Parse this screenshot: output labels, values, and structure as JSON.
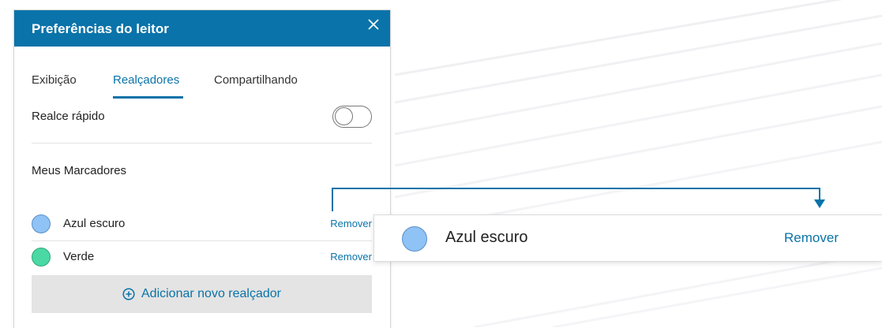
{
  "panel": {
    "title": "Preferências do leitor",
    "close_icon": "close-icon",
    "tabs": [
      {
        "label": "Exibição",
        "active": false
      },
      {
        "label": "Realçadores",
        "active": true
      },
      {
        "label": "Compartilhando",
        "active": false
      }
    ],
    "quick_highlight": {
      "label": "Realce rápido",
      "enabled": false
    },
    "markers_title": "Meus Marcadores",
    "highlighters": [
      {
        "name": "Azul escuro",
        "color": "#8fc2f5",
        "remove_label": "Remover"
      },
      {
        "name": "Verde",
        "color": "#4ad8a4",
        "remove_label": "Remover"
      }
    ],
    "add_button": {
      "label": "Adicionar novo realçador",
      "icon": "plus-circle-icon"
    }
  },
  "zoom": {
    "name": "Azul escuro",
    "color": "#8fc2f5",
    "remove_label": "Remover"
  },
  "colors": {
    "accent": "#0a73a9",
    "header_bg": "#0a73a9",
    "button_bg": "#e4e4e4"
  }
}
